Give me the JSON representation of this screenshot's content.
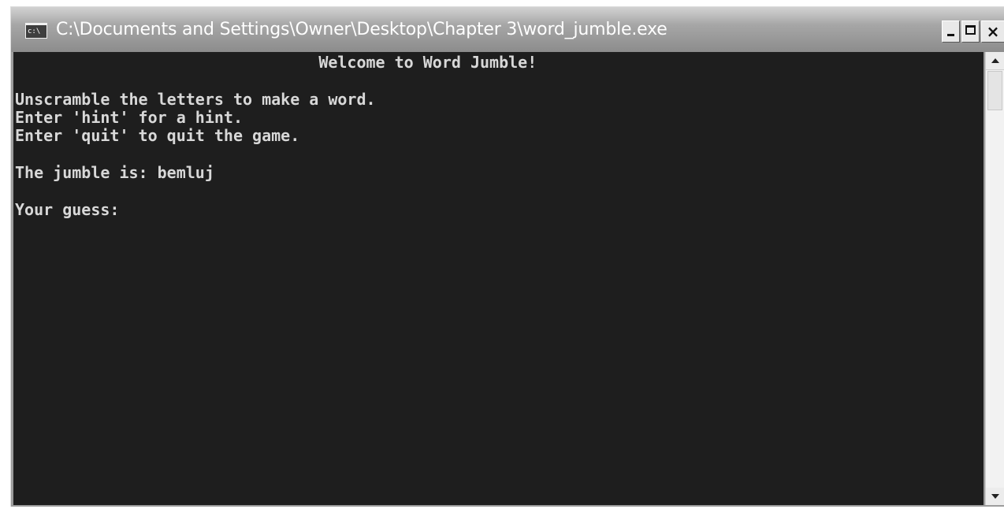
{
  "window": {
    "title": "C:\\Documents and Settings\\Owner\\Desktop\\Chapter 3\\word_jumble.exe",
    "icon": "command-prompt-icon",
    "icon_text": "c:\\",
    "controls": {
      "minimize_icon": "minimize-icon",
      "maximize_icon": "maximize-icon",
      "close_icon": "close-icon",
      "close_glyph": "×"
    }
  },
  "console": {
    "background": "#1e1e1e",
    "foreground": "#d8d8d8",
    "lines": [
      "                                Welcome to Word Jumble!",
      "Unscramble the letters to make a word.",
      "Enter 'hint' for a hint.",
      "Enter 'quit' to quit the game.",
      "The jumble is: bemluj",
      "Your guess:"
    ]
  },
  "scrollbar": {
    "up_icon": "scroll-up-arrow-icon",
    "down_icon": "scroll-down-arrow-icon"
  }
}
